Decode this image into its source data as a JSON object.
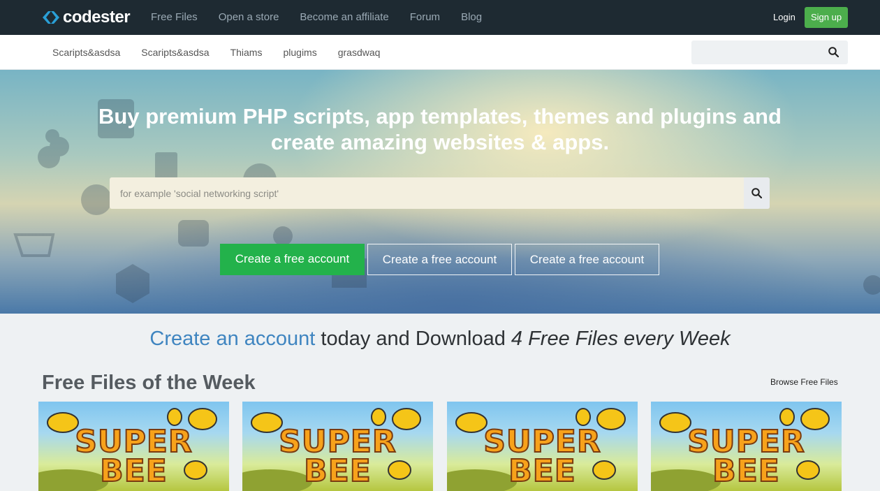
{
  "header": {
    "logo_text": "codester",
    "nav": [
      "Free Files",
      "Open a store",
      "Become an affiliate",
      "Forum",
      "Blog"
    ],
    "login_label": "Login",
    "signup_label": "Sign up"
  },
  "subnav": {
    "items": [
      "Scaripts&asdsa",
      "Scaripts&asdsa",
      "Thiams",
      "plugims",
      "grasdwaq"
    ],
    "search_placeholder": ""
  },
  "hero": {
    "title": "Buy premium PHP scripts, app templates, themes and plugins and create amazing websites & apps.",
    "search_placeholder": "for example 'social networking script'",
    "cta_buttons": [
      "Create a free account",
      "Create a free account",
      "Create a free account"
    ]
  },
  "promo": {
    "link_text": "Create an account",
    "middle_text": " today and Download ",
    "emphasis_text": "4 Free Files every Week"
  },
  "free_files": {
    "title": "Free Files of the Week",
    "browse_label": "Browse Free Files",
    "cards": [
      {
        "line1": "SUPER",
        "line2": "BEE"
      },
      {
        "line1": "SUPER",
        "line2": "BEE"
      },
      {
        "line1": "SUPER",
        "line2": "BEE"
      },
      {
        "line1": "SUPER",
        "line2": "BEE"
      }
    ]
  },
  "colors": {
    "topbar": "#1e2a32",
    "signup": "#4cae4c",
    "cta_primary": "#23b24b",
    "link_blue": "#3f85c0"
  }
}
